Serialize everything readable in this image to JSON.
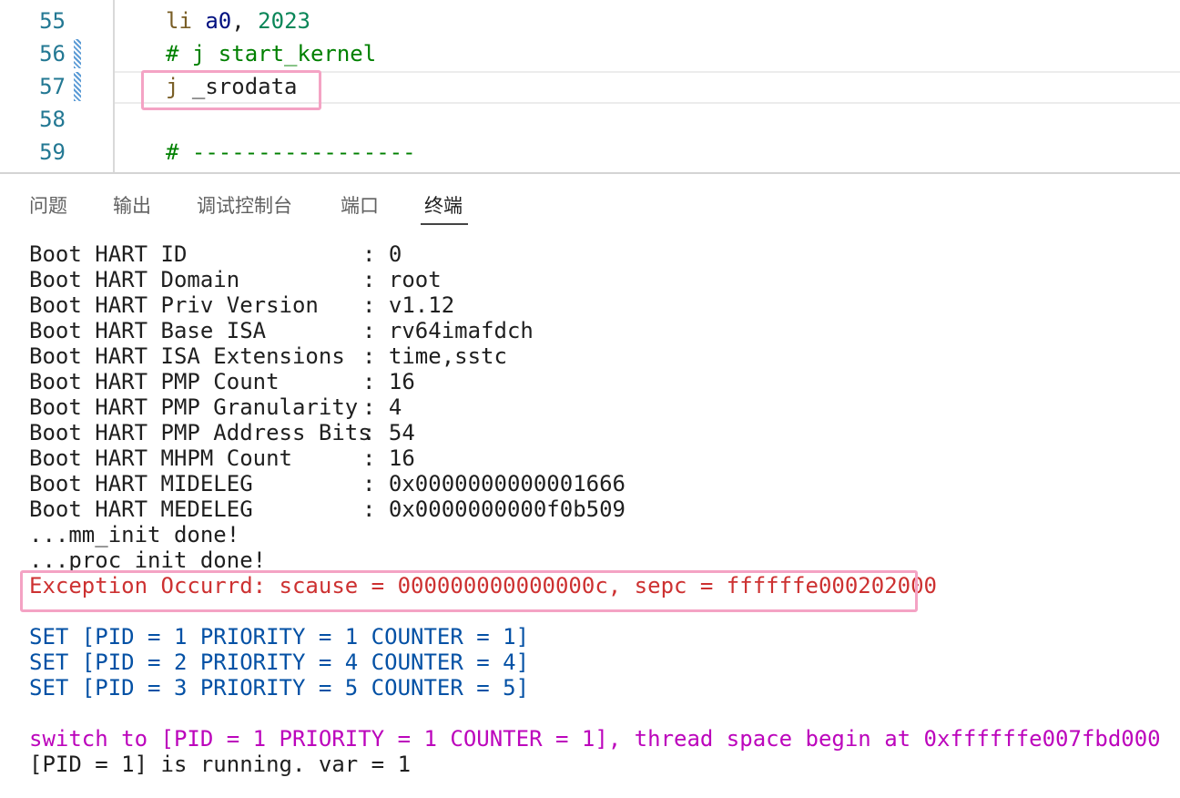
{
  "editor": {
    "line_numbers": [
      "55",
      "56",
      "57",
      "58",
      "59"
    ],
    "lines": [
      {
        "instr": "li",
        "reg": "a0",
        "comma": ", ",
        "num": "2023"
      },
      {
        "comment": "# j start_kernel"
      },
      {
        "instr": "j",
        "arg": " _srodata"
      },
      {},
      {
        "comment": "# -----------------"
      }
    ]
  },
  "panel": {
    "tabs": [
      "问题",
      "输出",
      "调试控制台",
      "端口",
      "终端"
    ],
    "active_tab": "终端"
  },
  "terminal": {
    "boot_info": [
      {
        "label": "Boot HART ID",
        "value": ": 0"
      },
      {
        "label": "Boot HART Domain",
        "value": ": root"
      },
      {
        "label": "Boot HART Priv Version",
        "value": ": v1.12"
      },
      {
        "label": "Boot HART Base ISA",
        "value": ": rv64imafdch"
      },
      {
        "label": "Boot HART ISA Extensions",
        "value": ": time,sstc"
      },
      {
        "label": "Boot HART PMP Count",
        "value": ": 16"
      },
      {
        "label": "Boot HART PMP Granularity",
        "value": ": 4"
      },
      {
        "label": "Boot HART PMP Address Bits",
        "value": ": 54"
      },
      {
        "label": "Boot HART MHPM Count",
        "value": ": 16"
      },
      {
        "label": "Boot HART MIDELEG",
        "value": ": 0x0000000000001666"
      },
      {
        "label": "Boot HART MEDELEG",
        "value": ": 0x0000000000f0b509"
      }
    ],
    "mm_init": "...mm_init done!",
    "proc_init": "...proc_init done!",
    "exception": "Exception Occurrd: scause = 000000000000000c, sepc = ffffffe000202000",
    "set_lines": [
      "SET [PID = 1 PRIORITY = 1 COUNTER = 1]",
      "SET [PID = 2 PRIORITY = 4 COUNTER = 4]",
      "SET [PID = 3 PRIORITY = 5 COUNTER = 5]"
    ],
    "switch_line": "switch to [PID = 1 PRIORITY = 1 COUNTER = 1], thread space begin at 0xffffffe007fbd000",
    "running_line": "[PID = 1] is running. var = 1"
  },
  "colors": {
    "line_number": "#237893",
    "comment": "#008000",
    "error": "#cd3131",
    "info": "#0451a5",
    "switch": "#bc05bc",
    "highlight_box": "#f4a3c4"
  }
}
